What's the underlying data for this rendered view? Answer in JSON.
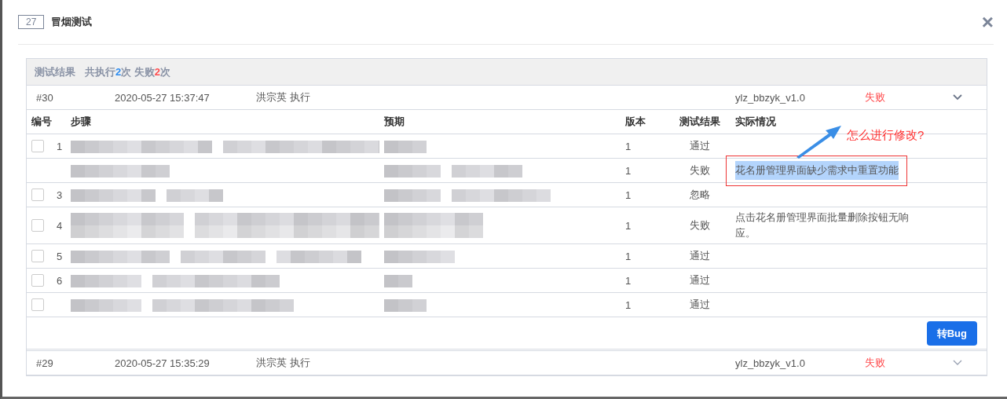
{
  "dialog": {
    "number": "27",
    "title": "冒烟测试",
    "close": "×"
  },
  "summary": {
    "label": "测试结果",
    "executed_prefix": "共执行",
    "executed_count": "2",
    "executed_suffix": "次",
    "failed_prefix": "失败",
    "failed_count": "2",
    "failed_suffix": "次"
  },
  "runs": [
    {
      "id": "#30",
      "time": "2020-05-27 15:37:47",
      "executor": "洪宗英 执行",
      "version": "ylz_bbzyk_v1.0",
      "result": "失败",
      "expanded": true,
      "columns": [
        "编号",
        "步骤",
        "预期",
        "版本",
        "测试结果",
        "实际情况"
      ],
      "steps": [
        {
          "checked": false,
          "number": "1",
          "version": "1",
          "result": "通过"
        },
        {
          "version": "1",
          "result": "失败",
          "actual": "花名册管理界面缺少需求中重置功能",
          "highlighted": true
        },
        {
          "checked": false,
          "number": "3",
          "version": "1",
          "result": "忽略"
        },
        {
          "checked": false,
          "number": "4",
          "version": "1",
          "result": "失败",
          "actual": "点击花名册管理界面批量删除按钮无响应。"
        },
        {
          "checked": false,
          "number": "5",
          "version": "1",
          "result": "通过"
        },
        {
          "checked": false,
          "number": "6",
          "version": "1",
          "result": "通过"
        },
        {
          "checked": false,
          "version": "1",
          "result": "通过"
        }
      ],
      "button": "转Bug"
    },
    {
      "id": "#29",
      "time": "2020-05-27 15:35:29",
      "executor": "洪宗英 执行",
      "version": "ylz_bbzyk_v1.0",
      "result": "失败",
      "expanded": false
    }
  ],
  "annotation": {
    "text": "怎么进行修改?"
  }
}
